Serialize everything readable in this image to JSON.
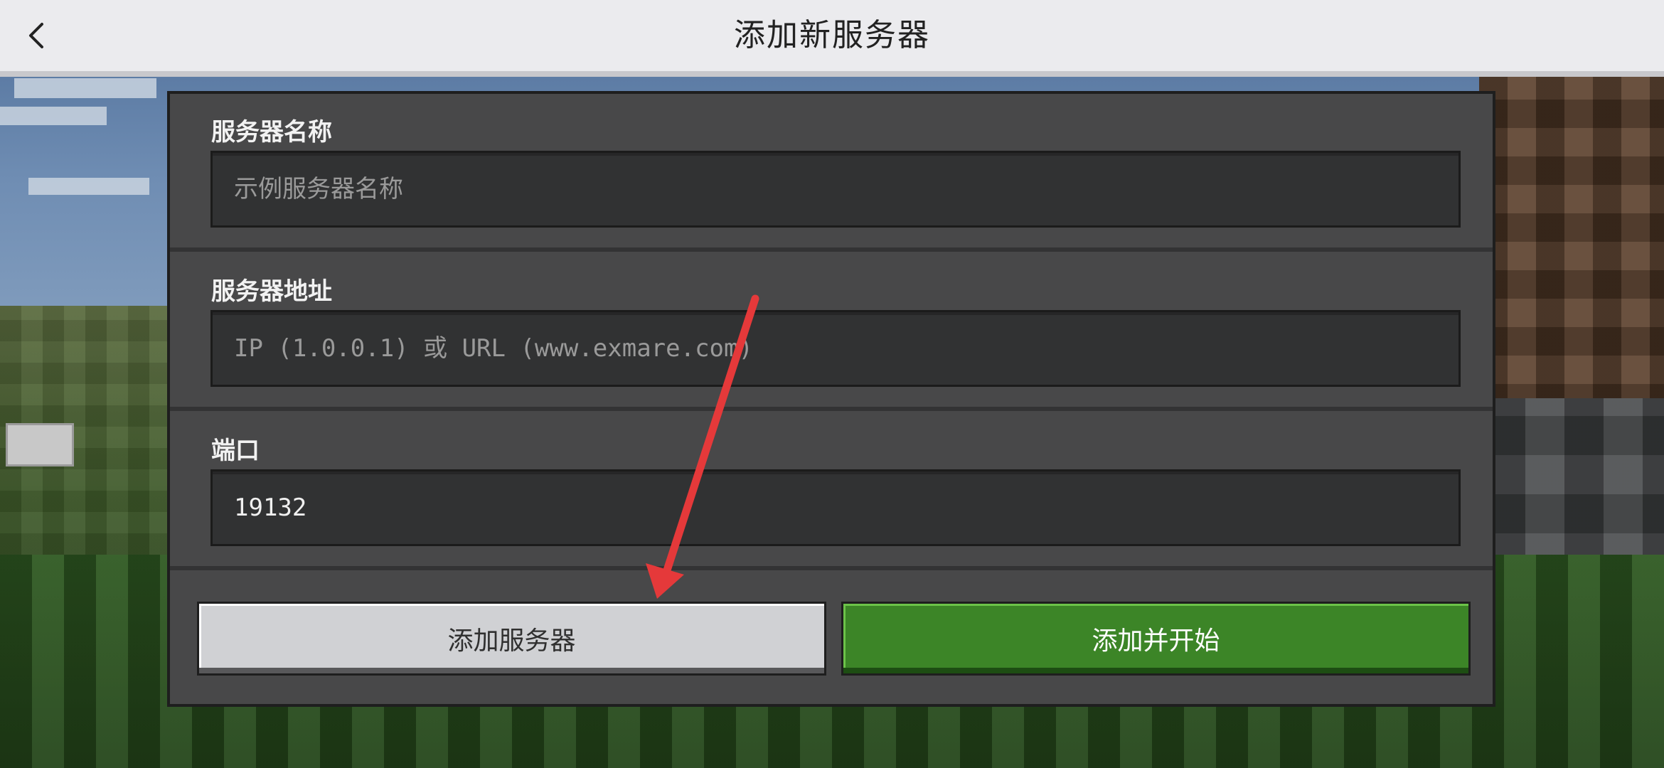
{
  "header": {
    "back_icon": "chevron-left-icon",
    "title": "添加新服务器"
  },
  "form": {
    "server_name": {
      "label": "服务器名称",
      "value": "",
      "placeholder": "示例服务器名称"
    },
    "server_address": {
      "label": "服务器地址",
      "value": "",
      "placeholder": "IP (1.0.0.1) 或 URL (www.exmare.com)"
    },
    "port": {
      "label": "端口",
      "value": "19132",
      "placeholder": ""
    }
  },
  "buttons": {
    "add_server": "添加服务器",
    "add_and_start": "添加并开始"
  },
  "colors": {
    "accent_green": "#3c8527",
    "annotation_arrow": "#e5393a"
  }
}
